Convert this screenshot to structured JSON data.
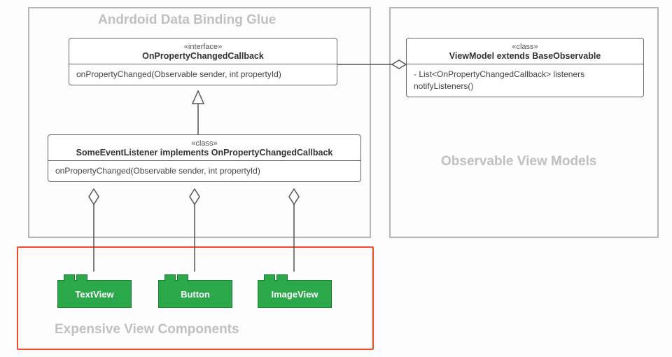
{
  "groups": {
    "databinding": {
      "title": "Andrdoid Data Binding Glue"
    },
    "observable": {
      "title": "Observable View Models"
    },
    "expensive": {
      "title": "Expensive View Components"
    }
  },
  "uml": {
    "interface": {
      "stereo": "«interface»",
      "name": "OnPropertyChangedCallback",
      "method": "onPropertyChanged(Observable sender, int propertyId)"
    },
    "listener": {
      "stereo": "«class»",
      "name": "SomeEventListener implements OnPropertyChangedCallback",
      "method": "onPropertyChanged(Observable sender, int propertyId)"
    },
    "viewmodel": {
      "stereo": "«class»",
      "name": "ViewModel extends BaseObservable",
      "line1": "- List<OnPropertyChangedCallback> listeners",
      "line2": "notifyListeners()"
    }
  },
  "components": {
    "textview": "TextView",
    "button": "Button",
    "imageview": "ImageView"
  }
}
